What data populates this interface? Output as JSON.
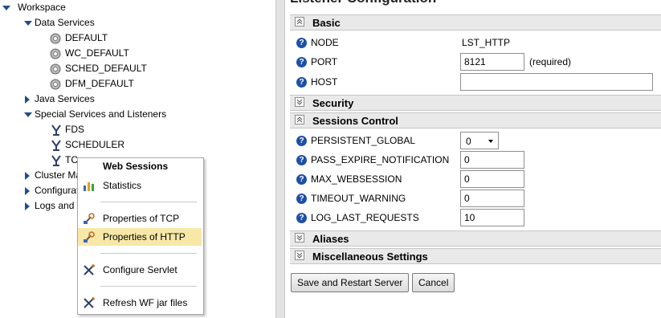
{
  "tree": {
    "workspace": "Workspace",
    "data_services": "Data Services",
    "data_items": [
      "DEFAULT",
      "WC_DEFAULT",
      "SCHED_DEFAULT",
      "DFM_DEFAULT"
    ],
    "java_services": "Java Services",
    "special_services": "Special Services and Listeners",
    "listener_items": [
      "FDS",
      "SCHEDULER",
      "TC"
    ],
    "cluster": "Cluster Ma",
    "configuration": "Configurat",
    "logs": "Logs and T"
  },
  "context_menu": {
    "title": "Web Sessions",
    "items": [
      "Statistics",
      "Properties of TCP",
      "Properties of HTTP",
      "Configure Servlet",
      "Refresh WF jar files"
    ],
    "highlighted": "Properties of HTTP"
  },
  "panel": {
    "heading": "Listener Configuration",
    "sections": {
      "basic": "Basic",
      "security": "Security",
      "sessions": "Sessions Control",
      "aliases": "Aliases",
      "misc": "Miscellaneous Settings"
    },
    "basic_fields": {
      "node_label": "NODE",
      "node_value": "LST_HTTP",
      "port_label": "PORT",
      "port_value": "8121",
      "port_note": "(required)",
      "host_label": "HOST",
      "host_value": ""
    },
    "session_fields": {
      "persistent_label": "PERSISTENT_GLOBAL",
      "persistent_value": "0",
      "pass_expire_label": "PASS_EXPIRE_NOTIFICATION",
      "pass_expire_value": "0",
      "max_web_label": "MAX_WEBSESSION",
      "max_web_value": "0",
      "timeout_label": "TIMEOUT_WARNING",
      "timeout_value": "0",
      "log_last_label": "LOG_LAST_REQUESTS",
      "log_last_value": "10"
    },
    "buttons": {
      "save": "Save and Restart Server",
      "cancel": "Cancel"
    }
  },
  "icons": {
    "help": "?"
  },
  "colors": {
    "accent": "#1e4fa6",
    "highlight": "#f7e8a8",
    "section_bg": "#e9e9e9"
  }
}
